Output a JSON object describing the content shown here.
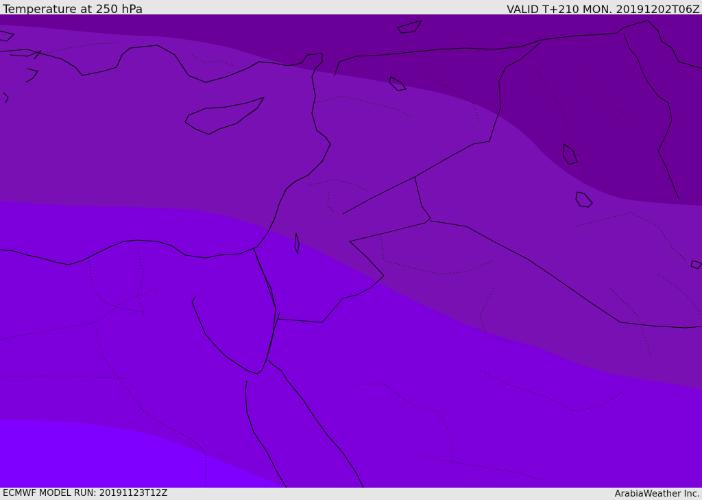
{
  "header": {
    "title": "Temperature at 250 hPa",
    "valid": "VALID T+210 MON. 20191202T06Z"
  },
  "footer": {
    "model_run": "ECMWF MODEL RUN: 20191123T12Z",
    "credit": "ArabiaWeather Inc."
  },
  "colors": {
    "coldest_band": "#6a0097",
    "cold_band": "#7910b3",
    "mid_band": "#7d00dc",
    "warm_band": "#7f00ff",
    "land_border": "#000000",
    "background": "#e6e6e6"
  }
}
